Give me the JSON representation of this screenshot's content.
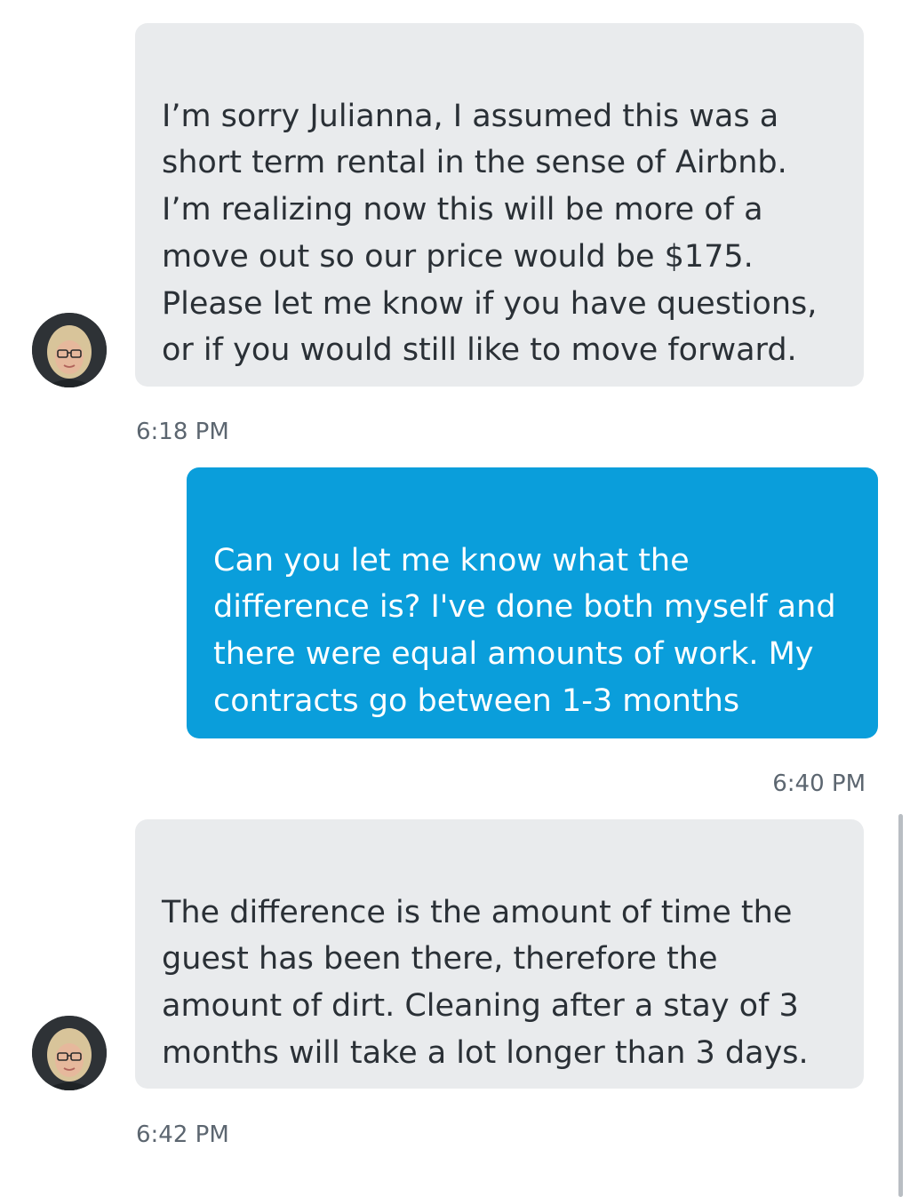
{
  "messages": [
    {
      "sender": "contact",
      "text": "I’m sorry Julianna, I assumed this was a short term rental in the sense of Airbnb. I’m realizing now this will be more of a move out so our price would be $175. Please let me know if you have questions, or if you would still like to move forward.",
      "time": "6:18 PM"
    },
    {
      "sender": "me",
      "text": "Can you let me know what the difference is? I've done both myself and there were equal amounts of work. My contracts go between 1-3 months",
      "time": "6:40 PM"
    },
    {
      "sender": "contact",
      "text": "The difference is the amount of time the guest has been there, therefore the amount of dirt. Cleaning after a stay of 3 months will take a lot longer than 3 days.",
      "time": "6:42 PM"
    }
  ],
  "avatar": {
    "icon": "contact-avatar-photo"
  },
  "colors": {
    "incoming_bubble": "#e9ebed",
    "incoming_text": "#2a3036",
    "outgoing_bubble": "#0a9edb",
    "outgoing_text": "#ffffff",
    "timestamp_text": "#5c6670"
  }
}
